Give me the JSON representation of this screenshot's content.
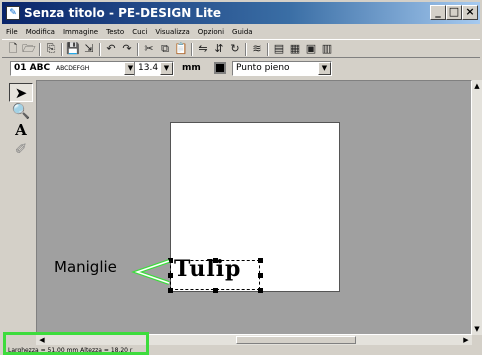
{
  "window": {
    "title": "Senza titolo - PE-DESIGN Lite",
    "controls": [
      "_",
      "□",
      "×"
    ]
  },
  "menu": [
    "File",
    "Modifica",
    "Immagine",
    "Testo",
    "Cuci",
    "Visualizza",
    "Opzioni",
    "Guida"
  ],
  "toolbar2": {
    "font_value": "01 ABC",
    "font_sample": "ABCDEFGH",
    "size_value": "13.4",
    "size_unit": "mm",
    "stitch_value": "Punto pieno"
  },
  "canvas": {
    "text_object": "Tulip"
  },
  "callout": {
    "label": "Maniglie"
  },
  "statusbar": {
    "text": "Larghezza = 51.00 mm  Altezza  = 18.20 r"
  },
  "colors": {
    "highlight": "#3ddc3d",
    "title_bar": "#0a246a"
  },
  "icons": [
    "app-icon",
    "new-icon",
    "open-icon",
    "save-icon",
    "save-as-icon",
    "undo-icon",
    "redo-icon",
    "cut-icon",
    "copy-icon",
    "paste-icon",
    "arrow-tool-icon",
    "zoom-tool-icon",
    "text-tool-icon",
    "manual-punch-icon"
  ]
}
